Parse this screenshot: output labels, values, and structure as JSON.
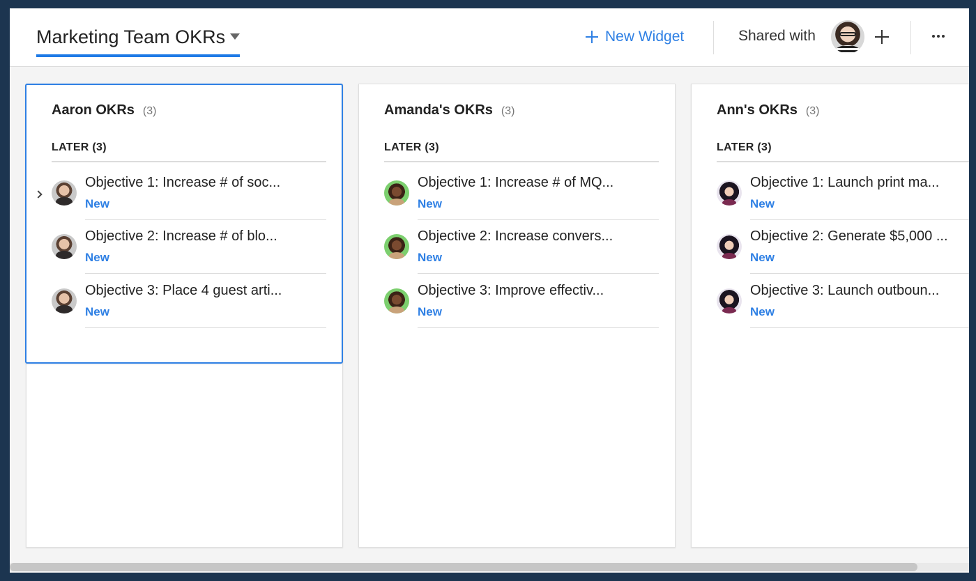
{
  "header": {
    "dashboard_title": "Marketing Team OKRs",
    "new_widget_label": "New Widget",
    "shared_with_label": "Shared with"
  },
  "widgets": [
    {
      "title": "Aaron OKRs",
      "count": "(3)",
      "section_label": "LATER (3)",
      "avatar": "aaron",
      "items": [
        {
          "text": "Objective 1: Increase # of soc...",
          "status": "New"
        },
        {
          "text": "Objective 2: Increase # of blo...",
          "status": "New"
        },
        {
          "text": "Objective 3: Place 4 guest arti...",
          "status": "New"
        }
      ]
    },
    {
      "title": "Amanda's OKRs",
      "count": "(3)",
      "section_label": "LATER (3)",
      "avatar": "amanda",
      "items": [
        {
          "text": "Objective 1: Increase # of MQ...",
          "status": "New"
        },
        {
          "text": "Objective 2: Increase convers...",
          "status": "New"
        },
        {
          "text": "Objective 3: Improve effectiv...",
          "status": "New"
        }
      ]
    },
    {
      "title": "Ann's OKRs",
      "count": "(3)",
      "section_label": "LATER (3)",
      "avatar": "ann",
      "items": [
        {
          "text": "Objective 1: Launch print ma...",
          "status": "New"
        },
        {
          "text": "Objective 2: Generate $5,000 ...",
          "status": "New"
        },
        {
          "text": "Objective 3: Launch outboun...",
          "status": "New"
        }
      ]
    }
  ],
  "colors": {
    "accent": "#2f80e4",
    "frame": "#1c3550"
  }
}
